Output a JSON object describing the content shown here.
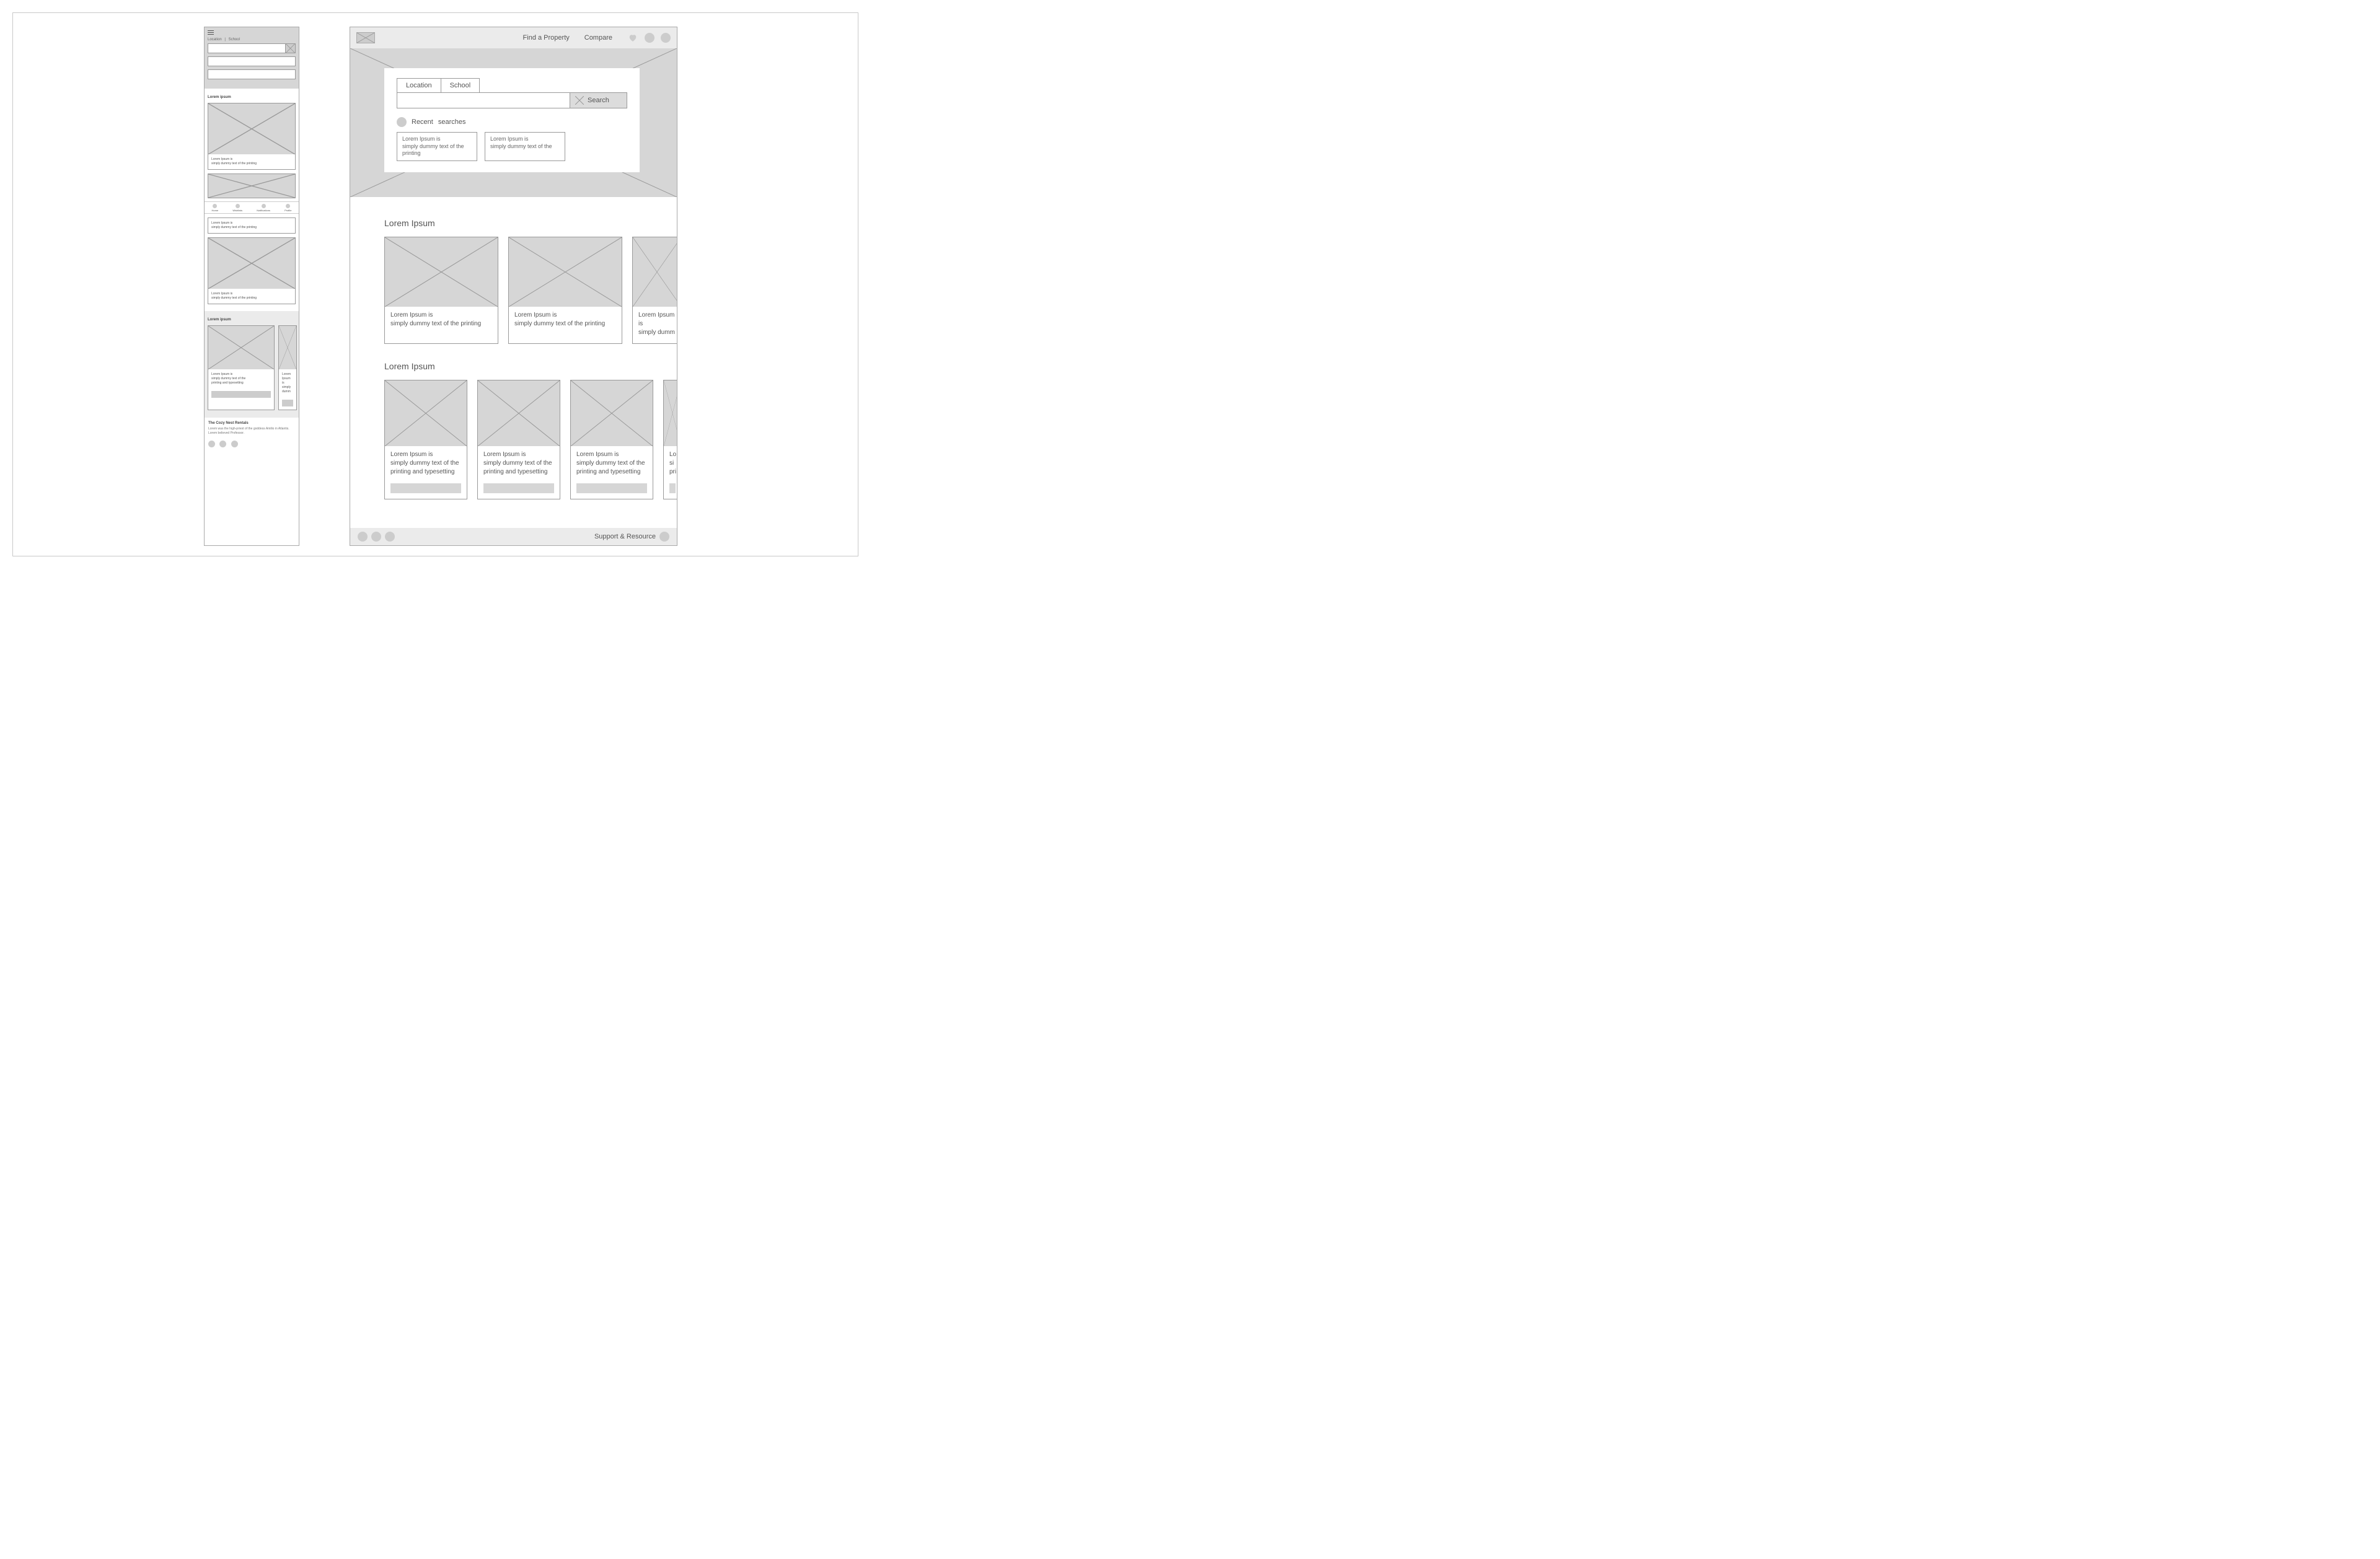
{
  "mobile": {
    "tabs": {
      "location": "Location",
      "divider": "|",
      "school": "School"
    },
    "section1_heading": "Lorem ipsum",
    "card_text": {
      "line1": "Lorem Ipsum is",
      "line2": "simply dummy text of the printing"
    },
    "nav": {
      "home": "Home",
      "wishlists": "Wishlists",
      "notifications": "Notifications",
      "profile": "Profile"
    },
    "section2_heading": "Lorem ipsum",
    "mini_card_text": {
      "line1": "Lorem Ipsum is",
      "line2": "simply dummy text of the",
      "line3": "printing and typesetting"
    },
    "mini_card2_text": {
      "line1": "Lorem Ipsum is",
      "line2": "simply dumm"
    },
    "footer": {
      "heading": "The Cozy Nest Rentals",
      "body": "Lorem was the high-priest of the goddess Amilio in Atlantis. Lorem believed Professor."
    }
  },
  "desktop": {
    "nav": {
      "find": "Find a Property",
      "compare": "Compare"
    },
    "tabs": {
      "location": "Location",
      "school": "School"
    },
    "search_button": "Search",
    "recent_label_a": "Recent",
    "recent_label_b": "searches",
    "recent_items": [
      {
        "line1": "Lorem Ipsum is",
        "line2": "simply dummy text of the printing"
      },
      {
        "line1": "Lorem Ipsum is",
        "line2": "simply dummy text of the"
      }
    ],
    "section1_heading": "Lorem Ipsum",
    "card_text": {
      "line1": "Lorem Ipsum is",
      "line2": "simply dummy text of the printing"
    },
    "card3_text": {
      "line1": "Lorem Ipsum is",
      "line2": "simply dumm"
    },
    "section2_heading": "Lorem Ipsum",
    "card2_text": {
      "line1": "Lorem Ipsum is",
      "line2": "simply dummy text of the",
      "line3": "printing and typesetting"
    },
    "card2_partial": {
      "line1": "Lo",
      "line2": "si",
      "line3": "pri"
    },
    "footer": {
      "support": "Support & Resource"
    }
  }
}
